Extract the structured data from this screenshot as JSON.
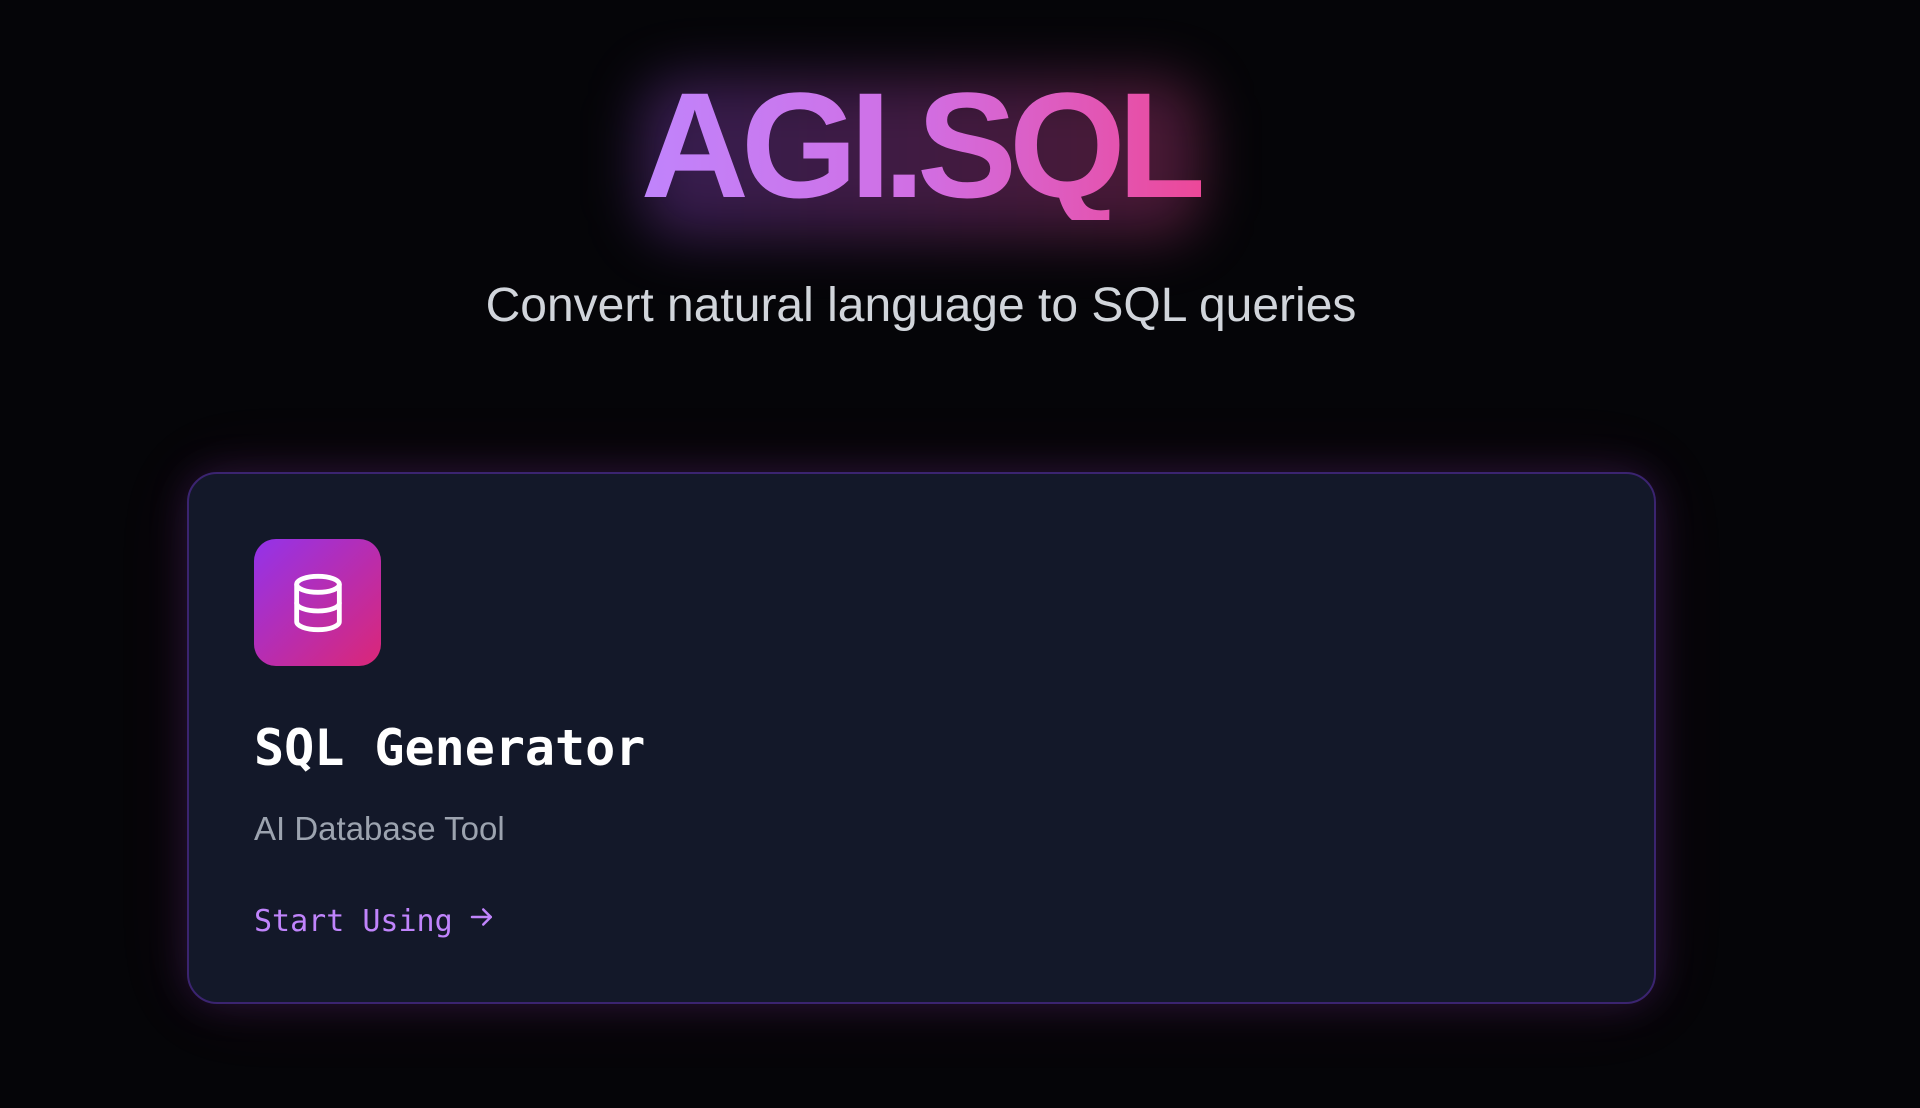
{
  "hero": {
    "brand": "AGI.SQL",
    "tagline": "Convert natural language to SQL queries"
  },
  "tool_card": {
    "icon": "database-icon",
    "title": "SQL Generator",
    "subtitle": "AI Database Tool",
    "link_label": "Start Using",
    "link_icon": "arrow-right-icon"
  },
  "colors": {
    "background": "#050508",
    "card_background": "#131829",
    "card_border": "#3b2470",
    "brand_gradient_start": "#c084fc",
    "brand_gradient_end": "#ec4899",
    "icon_gradient_start": "#9333ea",
    "icon_gradient_end": "#db2777",
    "tagline_text": "#d1d5db",
    "subtitle_text": "#9ca3af",
    "link_text": "#c084fc"
  }
}
